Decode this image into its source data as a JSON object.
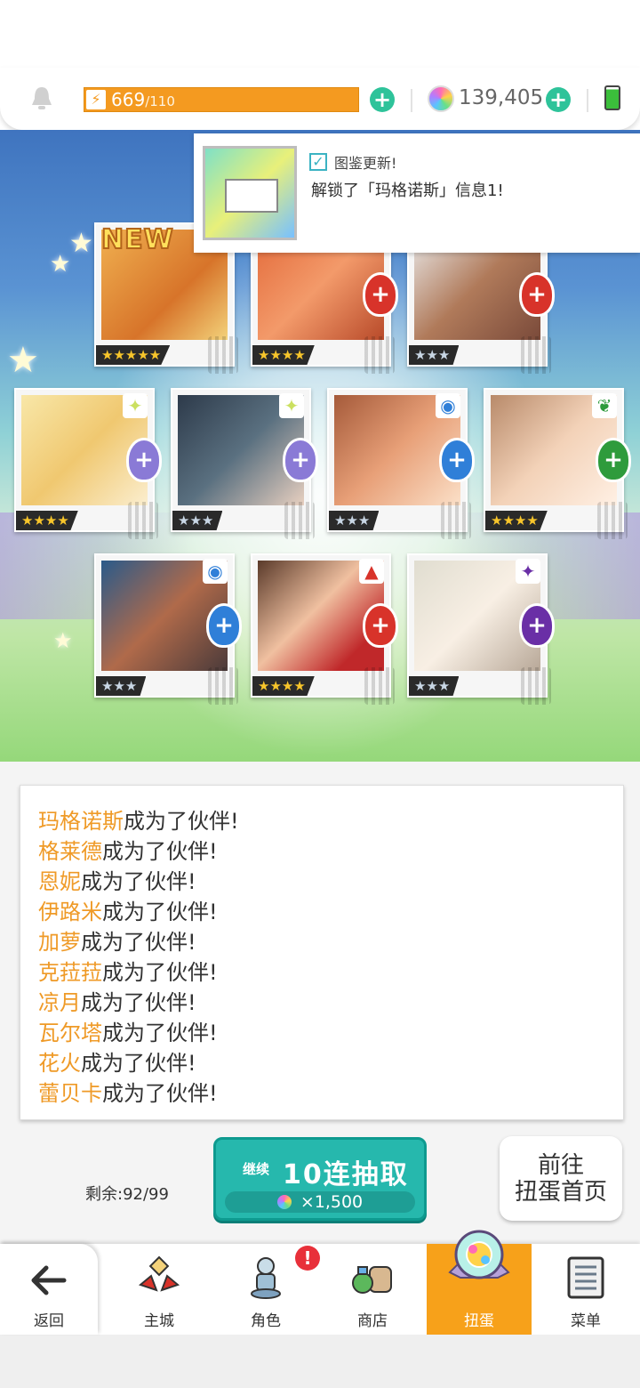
{
  "hud": {
    "stamina_current": "669",
    "stamina_max": "/110",
    "gem_count": "139,405"
  },
  "toast": {
    "title": "图鉴更新!",
    "message": "解锁了「玛格诺斯」信息1!"
  },
  "new_badge": "NEW",
  "cards": [
    {
      "rarity": "★★★★★",
      "element": "fire"
    },
    {
      "rarity": "★★★★",
      "element": "fire"
    },
    {
      "rarity": "★★★",
      "element": "fire"
    },
    {
      "rarity": "★★★★",
      "element": "light"
    },
    {
      "rarity": "★★★",
      "element": "light"
    },
    {
      "rarity": "★★★",
      "element": "water"
    },
    {
      "rarity": "★★★★",
      "element": "wind"
    },
    {
      "rarity": "★★★",
      "element": "water"
    },
    {
      "rarity": "★★★★",
      "element": "fire"
    },
    {
      "rarity": "★★★",
      "element": "dark"
    }
  ],
  "log": {
    "suffix": "成为了伙伴!",
    "names": [
      "玛格诺斯",
      "格莱德",
      "恩妮",
      "伊路米",
      "加萝",
      "克菈菈",
      "凉月",
      "瓦尔塔",
      "花火",
      "蕾贝卡"
    ]
  },
  "gacha": {
    "remaining_label": "剩余:",
    "remaining_value": "92/99",
    "continue_label": "继续",
    "pull_label": "10连抽取",
    "cost": "×1,500",
    "home_label_line1": "前往",
    "home_label_line2": "扭蛋首页"
  },
  "nav": {
    "back": "返回",
    "items": [
      "主城",
      "角色",
      "商店",
      "扭蛋",
      "菜单"
    ],
    "alert": "!"
  },
  "colors": {
    "accent_orange": "#f7a11a",
    "teal": "#26b8ad",
    "name_orange": "#ef9a27",
    "fire": "#d8332a",
    "water": "#2f7fd8",
    "light": "#8a7ad6",
    "wind": "#2e9b3c",
    "dark": "#6a2fa6"
  }
}
